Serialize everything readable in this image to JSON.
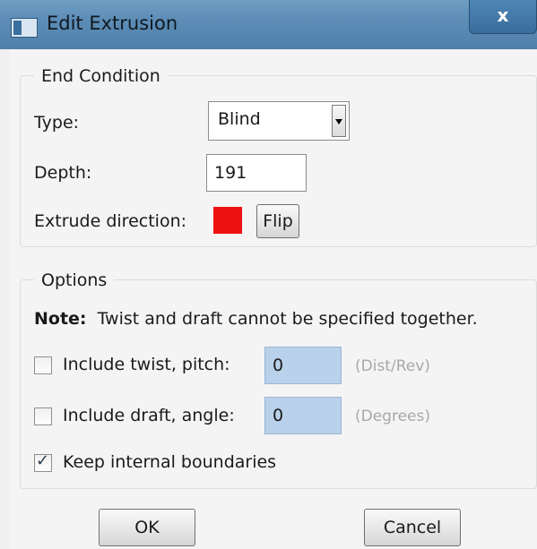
{
  "window": {
    "title": "Edit Extrusion",
    "close_glyph": "x"
  },
  "end_condition": {
    "group_title": "End Condition",
    "type_label": "Type:",
    "type_value": "Blind",
    "depth_label": "Depth:",
    "depth_value": "191",
    "direction_label": "Extrude direction:",
    "direction_color": "#ee1111",
    "flip_label": "Flip"
  },
  "options": {
    "group_title": "Options",
    "note_bold": "Note:",
    "note_text": "Twist and draft cannot be specified together.",
    "twist": {
      "label": "Include twist, pitch:",
      "checked": false,
      "value": "0",
      "unit": "(Dist/Rev)"
    },
    "draft": {
      "label": "Include draft, angle:",
      "checked": false,
      "value": "0",
      "unit": "(Degrees)"
    },
    "keep_boundaries": {
      "label": "Keep internal boundaries",
      "checked": true
    }
  },
  "buttons": {
    "ok_label": "OK",
    "cancel_label": "Cancel"
  },
  "colors": {
    "title_bar": "#5d8db6",
    "field_highlight": "#b9d1ea"
  }
}
